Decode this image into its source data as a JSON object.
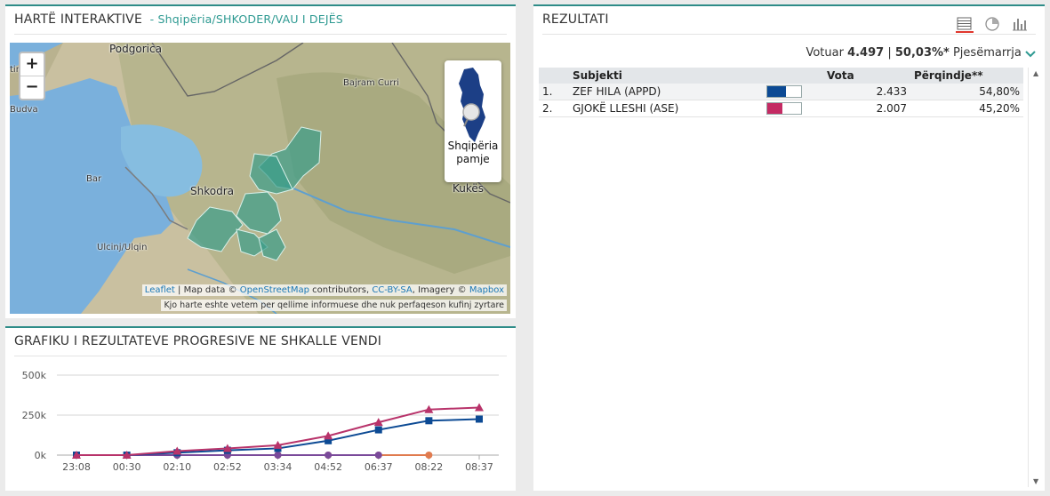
{
  "map_panel": {
    "title": "HARTË INTERAKTIVE",
    "breadcrumb": "- Shqipëria/SHKODER/VAU I DEJËS",
    "zoom_in": "+",
    "zoom_out": "−",
    "overview_label_1": "Shqipëria",
    "overview_label_2": "pamje",
    "attribution": {
      "leaflet": "Leaflet",
      "text1": " | Map data © ",
      "osm": "OpenStreetMap",
      "text2": " contributors, ",
      "license": "CC-BY-SA",
      "text3": ", Imagery © ",
      "mapbox": "Mapbox"
    },
    "disclaimer": "Kjo harte eshte vetem per qellime informuese dhe nuk perfaqeson kufinj zyrtare",
    "places": [
      "Podgorica",
      "tinje",
      "Budva",
      "Bajram Curri",
      "Bar",
      "Shkodra",
      "Kukës",
      "Ulcinj/Ulqin"
    ]
  },
  "chart_panel": {
    "title": "GRAFIKU I REZULTATEVE PROGRESIVE NE SHKALLE VENDI"
  },
  "chart_data": {
    "type": "line",
    "categories": [
      "23:08",
      "00:30",
      "02:10",
      "02:52",
      "03:34",
      "04:52",
      "06:37",
      "08:22",
      "08:37"
    ],
    "y_tick_labels": [
      "0k",
      "250k",
      "500k"
    ],
    "ylim": [
      0,
      500000
    ],
    "series": [
      {
        "color": "#b8336a",
        "marker": "triangle",
        "values": [
          0,
          0,
          25000,
          42000,
          62000,
          120000,
          205000,
          285000,
          297000
        ]
      },
      {
        "color": "#0c4a94",
        "marker": "square",
        "values": [
          0,
          0,
          15000,
          30000,
          42000,
          90000,
          158000,
          215000,
          225000
        ]
      },
      {
        "color": "#7a4a9a",
        "marker": "circle",
        "values": [
          0,
          0,
          0,
          0,
          0,
          0,
          0,
          null,
          null
        ]
      },
      {
        "color": "#e07b4f",
        "marker": "circle",
        "values": [
          0,
          0,
          0,
          0,
          0,
          0,
          0,
          0,
          null
        ]
      }
    ],
    "grid": true
  },
  "results_panel": {
    "title": "REZULTATI",
    "icons": [
      "table-view-icon",
      "pie-chart-icon",
      "bar-chart-icon"
    ],
    "voted_label": "Votuar",
    "voted_value": "4.497",
    "pipe": "|",
    "turnout_value": "50,03%*",
    "turnout_label": "Pjesëmarrja",
    "columns": {
      "subject": "Subjekti",
      "votes": "Vota",
      "percent": "Përqindje**"
    },
    "rows": [
      {
        "rank": "1.",
        "name": "ZEF HILA (APPD)",
        "votes": "2.433",
        "percent": "54,80%",
        "share": 0.548,
        "color": "#0c4a94"
      },
      {
        "rank": "2.",
        "name": "GJOKË LLESHI (ASE)",
        "votes": "2.007",
        "percent": "45,20%",
        "share": 0.452,
        "color": "#c42a63"
      }
    ]
  }
}
